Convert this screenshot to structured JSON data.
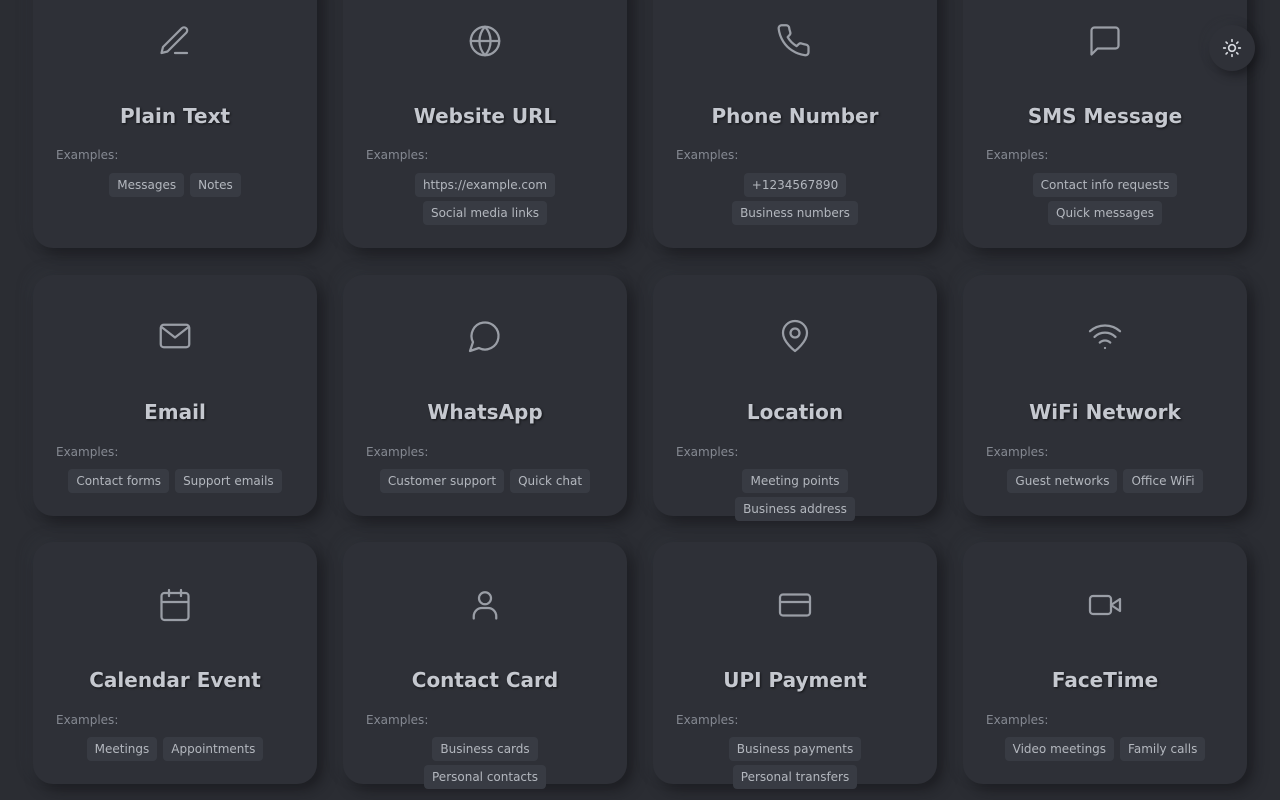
{
  "theme_toggle": {
    "icon": "sun-icon"
  },
  "examples_label": "Examples:",
  "cards": [
    {
      "title": "Plain Text",
      "icon": "pencil-icon",
      "examples": [
        "Messages",
        "Notes"
      ]
    },
    {
      "title": "Website URL",
      "icon": "globe-icon",
      "examples": [
        "https://example.com",
        "Social media links"
      ]
    },
    {
      "title": "Phone Number",
      "icon": "phone-icon",
      "examples": [
        "+1234567890",
        "Business numbers"
      ]
    },
    {
      "title": "SMS Message",
      "icon": "message-square-icon",
      "examples": [
        "Contact info requests",
        "Quick messages"
      ]
    },
    {
      "title": "Email",
      "icon": "mail-icon",
      "examples": [
        "Contact forms",
        "Support emails"
      ]
    },
    {
      "title": "WhatsApp",
      "icon": "message-circle-icon",
      "examples": [
        "Customer support",
        "Quick chat"
      ]
    },
    {
      "title": "Location",
      "icon": "map-pin-icon",
      "examples": [
        "Meeting points",
        "Business address"
      ]
    },
    {
      "title": "WiFi Network",
      "icon": "wifi-icon",
      "examples": [
        "Guest networks",
        "Office WiFi"
      ]
    },
    {
      "title": "Calendar Event",
      "icon": "calendar-icon",
      "examples": [
        "Meetings",
        "Appointments"
      ]
    },
    {
      "title": "Contact Card",
      "icon": "user-icon",
      "examples": [
        "Business cards",
        "Personal contacts"
      ]
    },
    {
      "title": "UPI Payment",
      "icon": "credit-card-icon",
      "examples": [
        "Business payments",
        "Personal transfers"
      ]
    },
    {
      "title": "FaceTime",
      "icon": "video-icon",
      "examples": [
        "Video meetings",
        "Family calls"
      ]
    }
  ]
}
